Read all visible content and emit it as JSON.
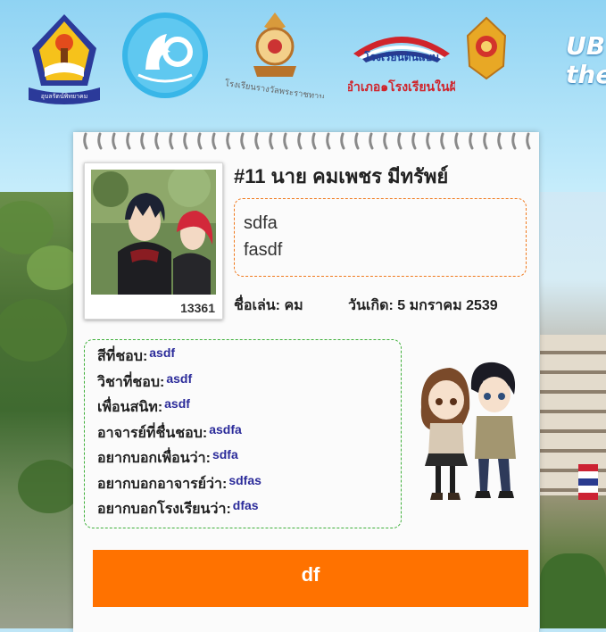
{
  "header": {
    "logo_1_caption": "อุบลรัตน์พิทยาคม",
    "logo_3_caption": "โรงเรียนรางวัลพระราชทาน",
    "logo_4_title": "โรงเรียนต้นแบบ",
    "logo_4_subtitle": "๑อำเภอ๑โรงเรียนในฝัน",
    "ub_text_line1": "UB",
    "ub_text_line2": "the"
  },
  "student": {
    "name": "#11 นาย คมเพชร มีทรัพย์",
    "id_number": "13361",
    "message_lines": [
      "sdfa",
      "fasdf"
    ],
    "nickname_text": "ชื่อเล่น: คม",
    "birthday_text": "วันเกิด: 5 มกราคม 2539"
  },
  "info": [
    {
      "label": "สีที่ชอบ:",
      "value": "asdf"
    },
    {
      "label": "วิชาที่ชอบ:",
      "value": "asdf"
    },
    {
      "label": "เพื่อนสนิท:",
      "value": "asdf"
    },
    {
      "label": "อาจารย์ที่ชื่นชอบ:",
      "value": "asdfa"
    },
    {
      "label": "อยากบอกเพื่อนว่า:",
      "value": "sdfa"
    },
    {
      "label": "อยากบอกอาจารย์ว่า:",
      "value": "sdfas"
    },
    {
      "label": "อยากบอกโรงเรียนว่า:",
      "value": "dfas"
    }
  ],
  "bottom_bar_text": "df",
  "colors": {
    "accent_orange": "#ff7200",
    "info_border_green": "#3fb03b",
    "message_border_orange": "#f07a1e",
    "value_blue": "#2b2b9a"
  }
}
